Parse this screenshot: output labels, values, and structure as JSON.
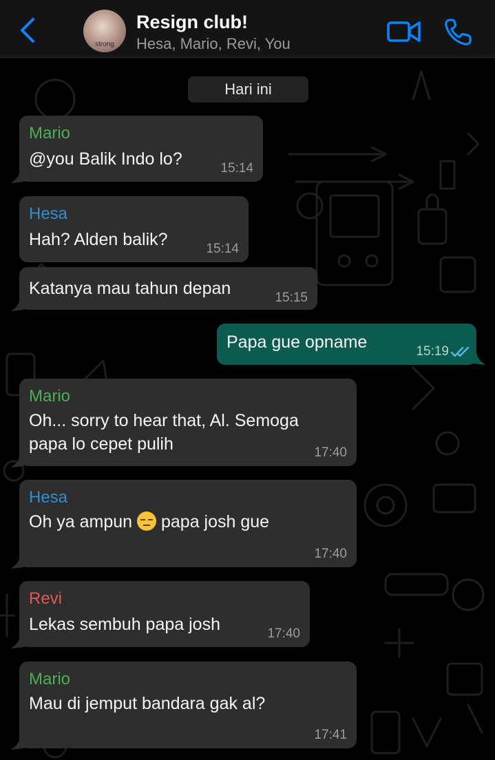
{
  "header": {
    "title": "Resign club!",
    "subtitle": "Hesa, Mario, Revi, You",
    "avatar_text": "strong",
    "icons": {
      "back": "chevron-left-icon",
      "video": "video-camera-icon",
      "phone": "phone-icon"
    },
    "accent_color": "#0a84ff"
  },
  "date_label": "Hari ini",
  "colors": {
    "mario": "#4caf50",
    "hesa": "#2f8fd0",
    "revi": "#e05a56",
    "incoming": "#2e2e2f",
    "outgoing": "#0b5c4e",
    "read_ticks": "#53bdeb"
  },
  "messages": [
    {
      "sender": "Mario",
      "line1": "@you Balik Indo lo?",
      "time": "15:14"
    },
    {
      "sender": "Hesa",
      "line1": "Hah? Alden balik?",
      "time": "15:14"
    },
    {
      "line1": "Katanya mau tahun depan",
      "time": "15:15"
    },
    {
      "line1": "Papa gue opname",
      "time": "15:19",
      "status": "read"
    },
    {
      "sender": "Mario",
      "line1": "Oh... sorry to hear that, Al. Semoga",
      "line2": "papa lo cepet pulih",
      "time": "17:40"
    },
    {
      "sender": "Hesa",
      "line1_a": "Oh ya ampun",
      "emoji": "pensive-face",
      "line1_b": "papa josh gue",
      "time": "17:40"
    },
    {
      "sender": "Revi",
      "line1": "Lekas sembuh papa josh",
      "time": "17:40"
    },
    {
      "sender": "Mario",
      "line1": "Mau di jemput bandara gak al?",
      "time": "17:41"
    }
  ]
}
